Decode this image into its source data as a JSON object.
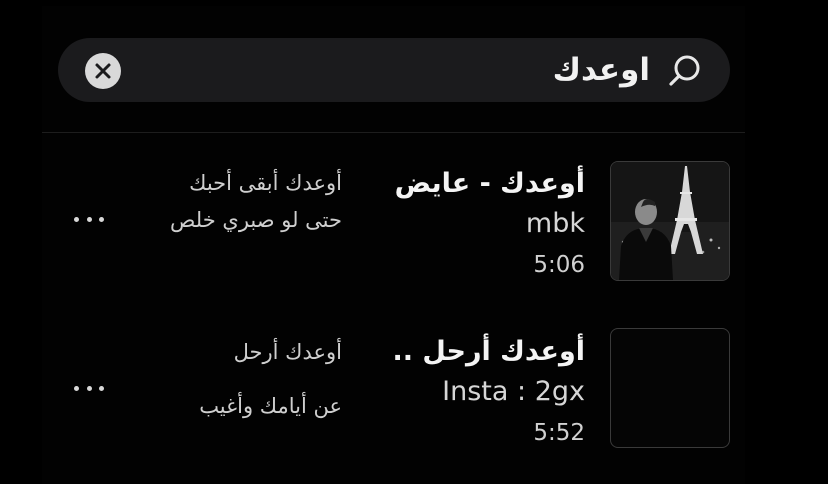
{
  "search": {
    "query": "اوعدك",
    "clear_icon": "close-icon",
    "search_icon": "search-icon"
  },
  "results": [
    {
      "title": "أوعدك - عايض",
      "artist": "mbk",
      "duration": "5:06",
      "lyric_line_1": "أوعدك أبقى أحبك",
      "lyric_line_2": "حتى لو صبري خلص",
      "thumbnail": "photo of person in front of Eiffel Tower"
    },
    {
      "title": "أوعدك أرحل ..",
      "artist": "Insta : 2gx",
      "duration": "5:52",
      "lyric_line_1": "أوعدك أرحل",
      "lyric_line_2": "عن أيامك وأغيب",
      "thumbnail": "blank"
    }
  ],
  "colors": {
    "background": "#000000",
    "search_field": "#1b1b1d",
    "text_primary": "#f4f4f4",
    "text_secondary": "#d0d0d0"
  }
}
